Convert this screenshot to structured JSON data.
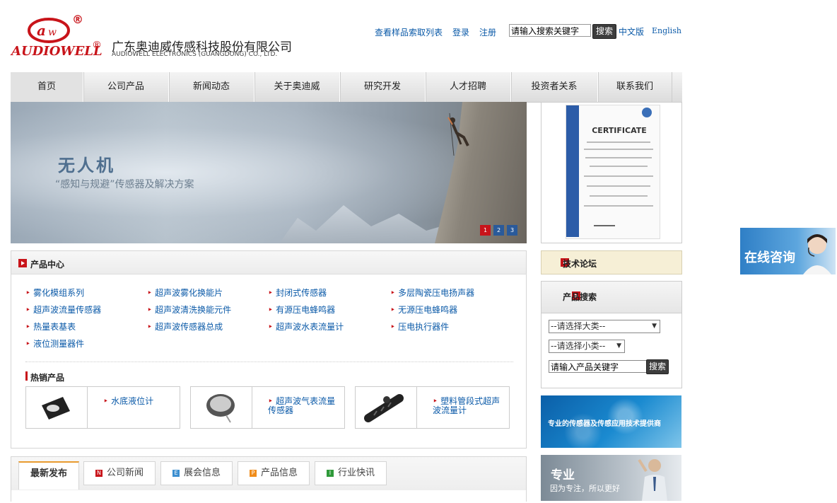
{
  "header": {
    "logo_word": "AUDIOWELL",
    "registered": "®",
    "company_cn": "广东奥迪威传感科技股份有限公司",
    "company_en": "AUDIOWELL ELECTRONICS (GUANGDONG) CO., LTD."
  },
  "toplinks": {
    "sample_list": "查看样品索取列表",
    "login": "登录",
    "register": "注册",
    "search_value": "请输入搜索关键字",
    "search_button": "搜索",
    "lang_cn": "中文版",
    "lang_en": "English"
  },
  "nav": [
    "首页",
    "公司产品",
    "新闻动态",
    "关于奥迪威",
    "研究开发",
    "人才招聘",
    "投资者关系",
    "联系我们"
  ],
  "banner": {
    "title": "无人机",
    "subtitle": "“感知与规避”传感器及解决方案",
    "dots": [
      "1",
      "2",
      "3"
    ],
    "active_dot": 0
  },
  "certificate": {
    "title": "CERTIFICATE"
  },
  "product_center": {
    "title": "产品中心",
    "links": [
      "雾化模组系列",
      "超声波雾化换能片",
      "封闭式传感器",
      "多层陶瓷压电扬声器",
      "超声波流量传感器",
      "超声波清洗换能元件",
      "有源压电蜂鸣器",
      "无源压电蜂鸣器",
      "热量表基表",
      "超声波传感器总成",
      "超声波水表流量计",
      "压电执行器件",
      "液位测量器件"
    ],
    "hot_title": "热销产品",
    "hot": [
      "水底液位计",
      "超声波气表流量传感器",
      "塑料管段式超声波流量计"
    ]
  },
  "sidebar": {
    "forum": "技术论坛",
    "product_search": "产品搜索",
    "select_main": "--请选择大类--",
    "select_sub": "--请选择小类--",
    "keyword_value": "请输入产品关键字",
    "search_button": "搜索",
    "banner1_text": "专业的传感器及传感应用技术提供商",
    "banner2_title": "专业",
    "banner2_sub": "因为专注，所以更好"
  },
  "consult": {
    "label": "在线咨询"
  },
  "news_tabs": [
    {
      "label": "最新发布",
      "icon": ""
    },
    {
      "label": "公司新闻",
      "icon": "N"
    },
    {
      "label": "展会信息",
      "icon": "E"
    },
    {
      "label": "产品信息",
      "icon": "P"
    },
    {
      "label": "行业快讯",
      "icon": "I"
    }
  ],
  "colors": {
    "brand_red": "#c8141a",
    "link_blue": "#0b5aa8",
    "tab_orange": "#e89b2f"
  }
}
